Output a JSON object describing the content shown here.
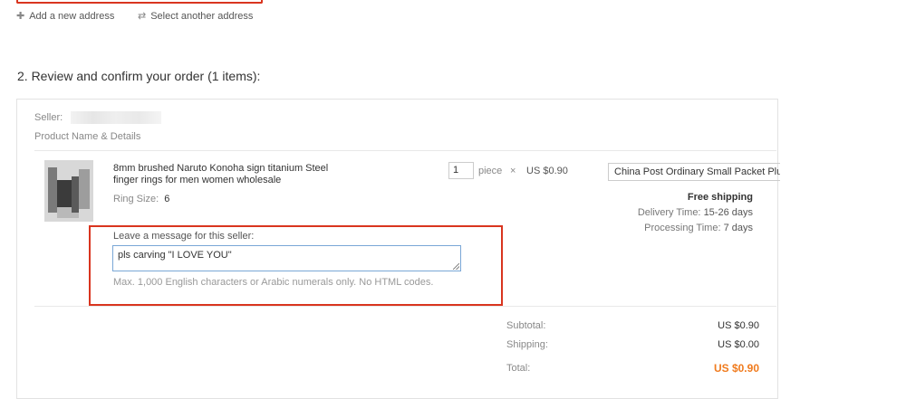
{
  "address": {
    "add_new": "Add a new address",
    "select_other": "Select another address"
  },
  "section": {
    "title": "2. Review and confirm your order (1 items):"
  },
  "order": {
    "seller_label": "Seller:",
    "product_header": "Product Name & Details",
    "item": {
      "name_line1": "8mm brushed Naruto Konoha sign titanium Steel",
      "name_line2": "finger rings for men women wholesale",
      "ring_size_label": "Ring Size:",
      "ring_size_value": "6",
      "quantity": "1",
      "unit": "piece",
      "times": "×",
      "price": "US $0.90",
      "shipping_method": "China Post Ordinary Small Packet Plus",
      "free_shipping": "Free shipping",
      "delivery_label": "Delivery Time:",
      "delivery_value": "15-26 days",
      "processing_label": "Processing Time:",
      "processing_value": "7 days"
    },
    "message": {
      "label": "Leave a message for this seller:",
      "value": "pls carving \"I LOVE YOU\"",
      "hint": "Max. 1,000 English characters or Arabic numerals only. No HTML codes."
    },
    "summary": {
      "subtotal_label": "Subtotal:",
      "subtotal_value": "US $0.90",
      "shipping_label": "Shipping:",
      "shipping_value": "US $0.00",
      "total_label": "Total:",
      "total_value": "US $0.90"
    }
  },
  "colors": {
    "highlight_border": "#d9351f",
    "total_accent": "#f07b1e"
  }
}
